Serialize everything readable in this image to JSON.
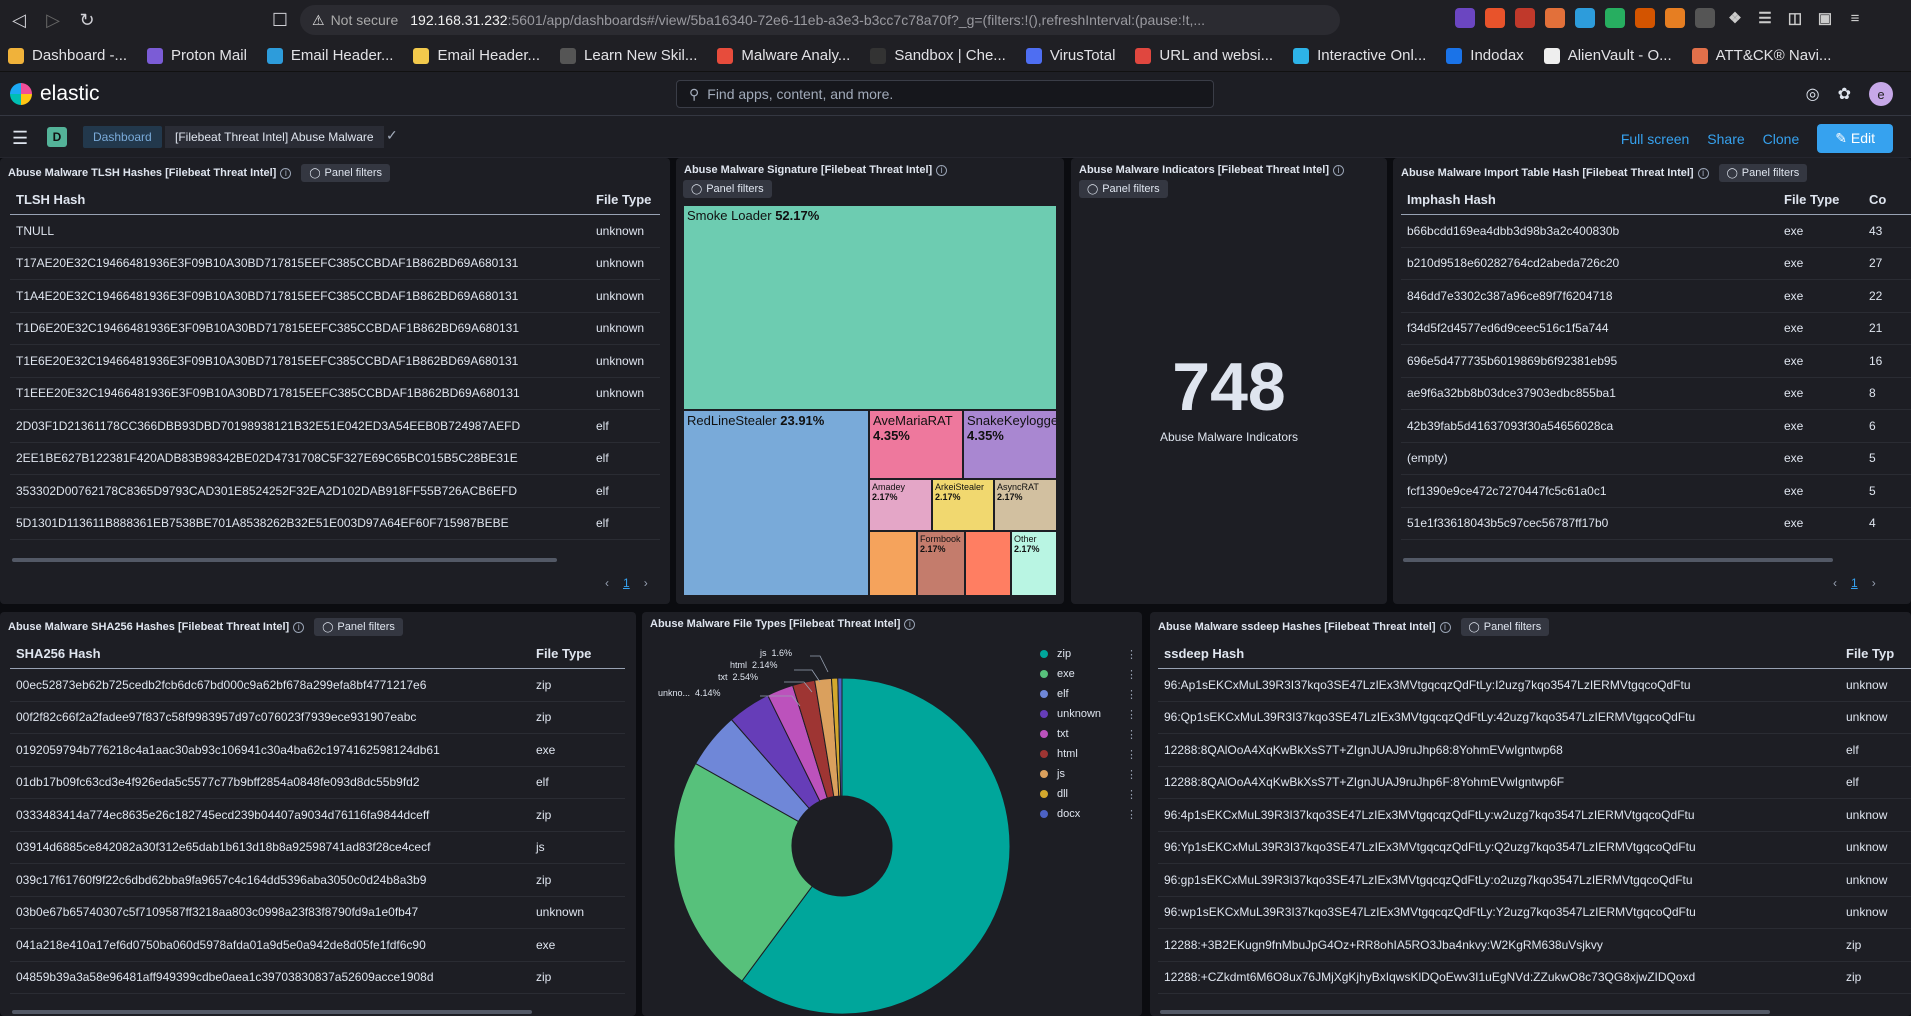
{
  "browser": {
    "url_warning": "Not secure",
    "url_host": "192.168.31.232",
    "url_rest": ":5601/app/dashboards#/view/5ba16340-72e6-11eb-a3e3-b3cc7c78a70f?_g=(filters:!(),refreshInterval:(pause:!t,..."
  },
  "bookmarks": [
    {
      "label": "Dashboard -...",
      "color": "#f0b23a"
    },
    {
      "label": "Proton Mail",
      "color": "#7b5cd6"
    },
    {
      "label": "Email Header...",
      "color": "#2d9cdb"
    },
    {
      "label": "Email Header...",
      "color": "#f2c94c"
    },
    {
      "label": "Learn New Skil...",
      "color": "#555"
    },
    {
      "label": "Malware Analy...",
      "color": "#e74c3c"
    },
    {
      "label": "Sandbox | Che...",
      "color": "#333"
    },
    {
      "label": "VirusTotal",
      "color": "#4e6ef2"
    },
    {
      "label": "URL and websi...",
      "color": "#e0473f"
    },
    {
      "label": "Interactive Onl...",
      "color": "#2db3e8"
    },
    {
      "label": "Indodax",
      "color": "#1a73e8"
    },
    {
      "label": "AlienVault - O...",
      "color": "#eee"
    },
    {
      "label": "ATT&CK® Navi...",
      "color": "#e2704a"
    }
  ],
  "header": {
    "app_name": "elastic",
    "search_placeholder": "Find apps, content, and more.",
    "avatar_letter": "e"
  },
  "subheader": {
    "space_letter": "D",
    "crumb_root": "Dashboard",
    "crumb_current": "[Filebeat Threat Intel] Abuse Malware",
    "full_screen": "Full screen",
    "share": "Share",
    "clone": "Clone",
    "edit": "Edit"
  },
  "panel_filters_label": "Panel filters",
  "tlsh": {
    "title": "Abuse Malware TLSH Hashes [Filebeat Threat Intel]",
    "col1": "TLSH Hash",
    "col2": "File Type",
    "rows": [
      [
        "TNULL",
        "unknown"
      ],
      [
        "T17AE20E32C19466481936E3F09B10A30BD717815EEFC385CCBDAF1B862BD69A680131",
        "unknown"
      ],
      [
        "T1A4E20E32C19466481936E3F09B10A30BD717815EEFC385CCBDAF1B862BD69A680131",
        "unknown"
      ],
      [
        "T1D6E20E32C19466481936E3F09B10A30BD717815EEFC385CCBDAF1B862BD69A680131",
        "unknown"
      ],
      [
        "T1E6E20E32C19466481936E3F09B10A30BD717815EEFC385CCBDAF1B862BD69A680131",
        "unknown"
      ],
      [
        "T1EEE20E32C19466481936E3F09B10A30BD717815EEFC385CCBDAF1B862BD69A680131",
        "unknown"
      ],
      [
        "2D03F1D21361178CC366DBB93DBD70198938121B32E51E042ED3A54EEB0B724987AEFD",
        "elf"
      ],
      [
        "2EE1BE627B122381F420ADB83B98342BE02D4731708C5F327E69C65BC015B5C28BE31E",
        "elf"
      ],
      [
        "353302D00762178C8365D9793CAD301E8524252F32EA2D102DAB918FF55B726ACB6EFD",
        "elf"
      ],
      [
        "5D1301D113611B888361EB7538BE701A8538262B32E51E003D97A64EF60F715987BEBE",
        "elf"
      ]
    ],
    "page": "1"
  },
  "signature": {
    "title": "Abuse Malware Signature [Filebeat Threat Intel]"
  },
  "treemap": [
    {
      "name": "Smoke Loader",
      "pct": "52.17%",
      "value": 52.17,
      "color": "#6dccb1"
    },
    {
      "name": "RedLineStealer",
      "pct": "23.91%",
      "value": 23.91,
      "color": "#79aad9"
    },
    {
      "name": "AveMariaRAT",
      "pct": "4.35%",
      "value": 4.35,
      "color": "#ee789d"
    },
    {
      "name": "SnakeKeylogger",
      "pct": "4.35%",
      "value": 4.35,
      "color": "#a987d1"
    },
    {
      "name": "Amadey",
      "pct": "2.17%",
      "value": 2.17,
      "color": "#e4a6c7"
    },
    {
      "name": "ArkeiStealer",
      "pct": "2.17%",
      "value": 2.17,
      "color": "#f1d86f"
    },
    {
      "name": "AsyncRAT",
      "pct": "2.17%",
      "value": 2.17,
      "color": "#d2c0a0"
    },
    {
      "name": "",
      "pct": "",
      "value": 2.17,
      "color": "#f5a35c"
    },
    {
      "name": "Formbook",
      "pct": "2.17%",
      "value": 2.17,
      "color": "#c47c6c"
    },
    {
      "name": "",
      "pct": "",
      "value": 2.17,
      "color": "#ff7e62"
    },
    {
      "name": "Other",
      "pct": "2.17%",
      "value": 2.17,
      "color": "#b9f5e3"
    }
  ],
  "indicators": {
    "title": "Abuse Malware Indicators [Filebeat Threat Intel]",
    "value": "748",
    "label": "Abuse Malware Indicators"
  },
  "imphash": {
    "title": "Abuse Malware Import Table Hash [Filebeat Threat Intel]",
    "col1": "Imphash Hash",
    "col2": "File Type",
    "col3": "Co",
    "rows": [
      [
        "b66bcdd169ea4dbb3d98b3a2c400830b",
        "exe",
        "43"
      ],
      [
        "b210d9518e60282764cd2abeda726c20",
        "exe",
        "27"
      ],
      [
        "846dd7e3302c387a96ce89f7f6204718",
        "exe",
        "22"
      ],
      [
        "f34d5f2d4577ed6d9ceec516c1f5a744",
        "exe",
        "21"
      ],
      [
        "696e5d477735b6019869b6f92381eb95",
        "exe",
        "16"
      ],
      [
        "ae9f6a32bb8b03dce37903edbc855ba1",
        "exe",
        "8"
      ],
      [
        "42b39fab5d41637093f30a54656028ca",
        "exe",
        "6"
      ],
      [
        "(empty)",
        "exe",
        "5"
      ],
      [
        "fcf1390e9ce472c7270447fc5c61a0c1",
        "exe",
        "5"
      ],
      [
        "51e1f33618043b5c97cec56787ff17b0",
        "exe",
        "4"
      ]
    ],
    "page": "1"
  },
  "sha256": {
    "title": "Abuse Malware SHA256 Hashes [Filebeat Threat Intel]",
    "col1": "SHA256 Hash",
    "col2": "File Type",
    "rows": [
      [
        "00ec52873eb62b725cedb2fcb6dc67bd000c9a62bf678a299efa8bf4771217e6",
        "zip"
      ],
      [
        "00f2f82c66f2a2fadee97f837c58f9983957d97c076023f7939ece931907eabc",
        "zip"
      ],
      [
        "0192059794b776218c4a1aac30ab93c106941c30a4ba62c1974162598124db61",
        "exe"
      ],
      [
        "01db17b09fc63cd3e4f926eda5c5577c77b9bff2854a0848fe093d8dc55b9fd2",
        "elf"
      ],
      [
        "0333483414a774ec8635e26c182745ecd239b04407a9034d76116fa9844dceff",
        "zip"
      ],
      [
        "03914d6885ce842082a30f312e65dab1b613d18b8a92598741ad83f28ce4cecf",
        "js"
      ],
      [
        "039c17f61760f9f22c6dbd62bba9fa9657c4c164dd5396aba3050c0d24b8a3b9",
        "zip"
      ],
      [
        "03b0e67b65740307c5f7109587ff3218aa803c0998a23f83f8790fd9a1e0fb47",
        "unknown"
      ],
      [
        "041a218e410a17ef6d0750ba060d5978afda01a9d5e0a942de8d05fe1fdf6c90",
        "exe"
      ],
      [
        "04859b39a3a58e96481aff949399cdbe0aea1c39703830837a52609acce1908d",
        "zip"
      ]
    ]
  },
  "filetypes": {
    "title": "Abuse Malware File Types [Filebeat Threat Intel]",
    "legend": [
      {
        "name": "zip",
        "color": "#00a69b"
      },
      {
        "name": "exe",
        "color": "#57c17b"
      },
      {
        "name": "elf",
        "color": "#6f87d8"
      },
      {
        "name": "unknown",
        "color": "#663db8"
      },
      {
        "name": "txt",
        "color": "#bc52bc"
      },
      {
        "name": "html",
        "color": "#9e3533"
      },
      {
        "name": "js",
        "color": "#daa05d"
      },
      {
        "name": "dll",
        "color": "#d3a82d"
      },
      {
        "name": "docx",
        "color": "#4c62c4"
      }
    ]
  },
  "chart_data": {
    "type": "pie",
    "title": "Abuse Malware File Types [Filebeat Threat Intel]",
    "slices": [
      {
        "name": "zip",
        "value": 60.1
      },
      {
        "name": "exe",
        "value": 23.0
      },
      {
        "name": "elf",
        "value": 5.4
      },
      {
        "name": "unknown",
        "value": 4.14
      },
      {
        "name": "txt",
        "value": 2.54
      },
      {
        "name": "html",
        "value": 2.14
      },
      {
        "name": "js",
        "value": 1.6
      },
      {
        "name": "dll",
        "value": 0.6
      },
      {
        "name": "docx",
        "value": 0.4
      }
    ],
    "labels": [
      {
        "name": "unkno...",
        "pct": "4.14%"
      },
      {
        "name": "txt",
        "pct": "2.54%"
      },
      {
        "name": "html",
        "pct": "2.14%"
      },
      {
        "name": "js",
        "pct": "1.6%"
      }
    ]
  },
  "ssdeep": {
    "title": "Abuse Malware ssdeep Hashes [Filebeat Threat Intel]",
    "col1": "ssdeep Hash",
    "col2": "File Typ",
    "rows": [
      [
        "96:Ap1sEKCxMuL39R3I37kqo3SE47LzIEx3MVtgqcqzQdFtLy:I2uzg7kqo3547LzIERMVtgqcoQdFtu",
        "unknow"
      ],
      [
        "96:Qp1sEKCxMuL39R3I37kqo3SE47LzIEx3MVtgqcqzQdFtLy:42uzg7kqo3547LzIERMVtgqcoQdFtu",
        "unknow"
      ],
      [
        "12288:8QAlOoA4XqKwBkXsS7T+ZIgnJUAJ9ruJhp68:8YohmEVwIgntwp68",
        "elf"
      ],
      [
        "12288:8QAlOoA4XqKwBkXsS7T+ZIgnJUAJ9ruJhp6F:8YohmEVwIgntwp6F",
        "elf"
      ],
      [
        "96:4p1sEKCxMuL39R3I37kqo3SE47LzIEx3MVtgqcqzQdFtLy:w2uzg7kqo3547LzIERMVtgqcoQdFtu",
        "unknow"
      ],
      [
        "96:Yp1sEKCxMuL39R3I37kqo3SE47LzIEx3MVtgqcqzQdFtLy:Q2uzg7kqo3547LzIERMVtgqcoQdFtu",
        "unknow"
      ],
      [
        "96:gp1sEKCxMuL39R3I37kqo3SE47LzIEx3MVtgqcqzQdFtLy:o2uzg7kqo3547LzIERMVtgqcoQdFtu",
        "unknow"
      ],
      [
        "96:wp1sEKCxMuL39R3I37kqo3SE47LzIEx3MVtgqcqzQdFtLy:Y2uzg7kqo3547LzIERMVtgqcoQdFtu",
        "unknow"
      ],
      [
        "12288:+3B2EKugn9fnMbuJpG4Oz+RR8ohIA5RO3Jba4nkvy:W2KgRM638uVsjkvy",
        "zip"
      ],
      [
        "12288:+CZkdmt6M6O8ux76JMjXgKjhyBxIqwsKlDQoEwv3I1uEgNVd:ZZukwO8c73QG8xjwZIDQoxd",
        "zip"
      ]
    ]
  }
}
